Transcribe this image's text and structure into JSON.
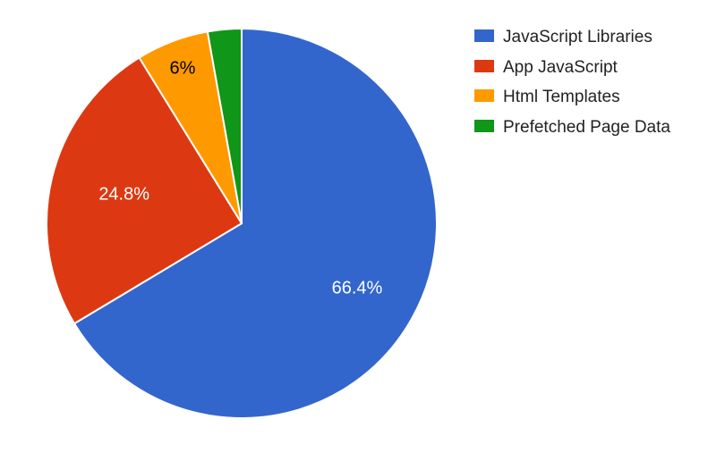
{
  "chart_data": {
    "type": "pie",
    "series": [
      {
        "name": "JavaScript Libraries",
        "value": 66.4,
        "color": "#3366cc",
        "label": "66.4%"
      },
      {
        "name": "App JavaScript",
        "value": 24.8,
        "color": "#dc3912",
        "label": "24.8%"
      },
      {
        "name": "Html Templates",
        "value": 6.0,
        "color": "#ff9900",
        "label": "6%"
      },
      {
        "name": "Prefetched Page Data",
        "value": 2.8,
        "color": "#109618",
        "label": ""
      }
    ]
  }
}
